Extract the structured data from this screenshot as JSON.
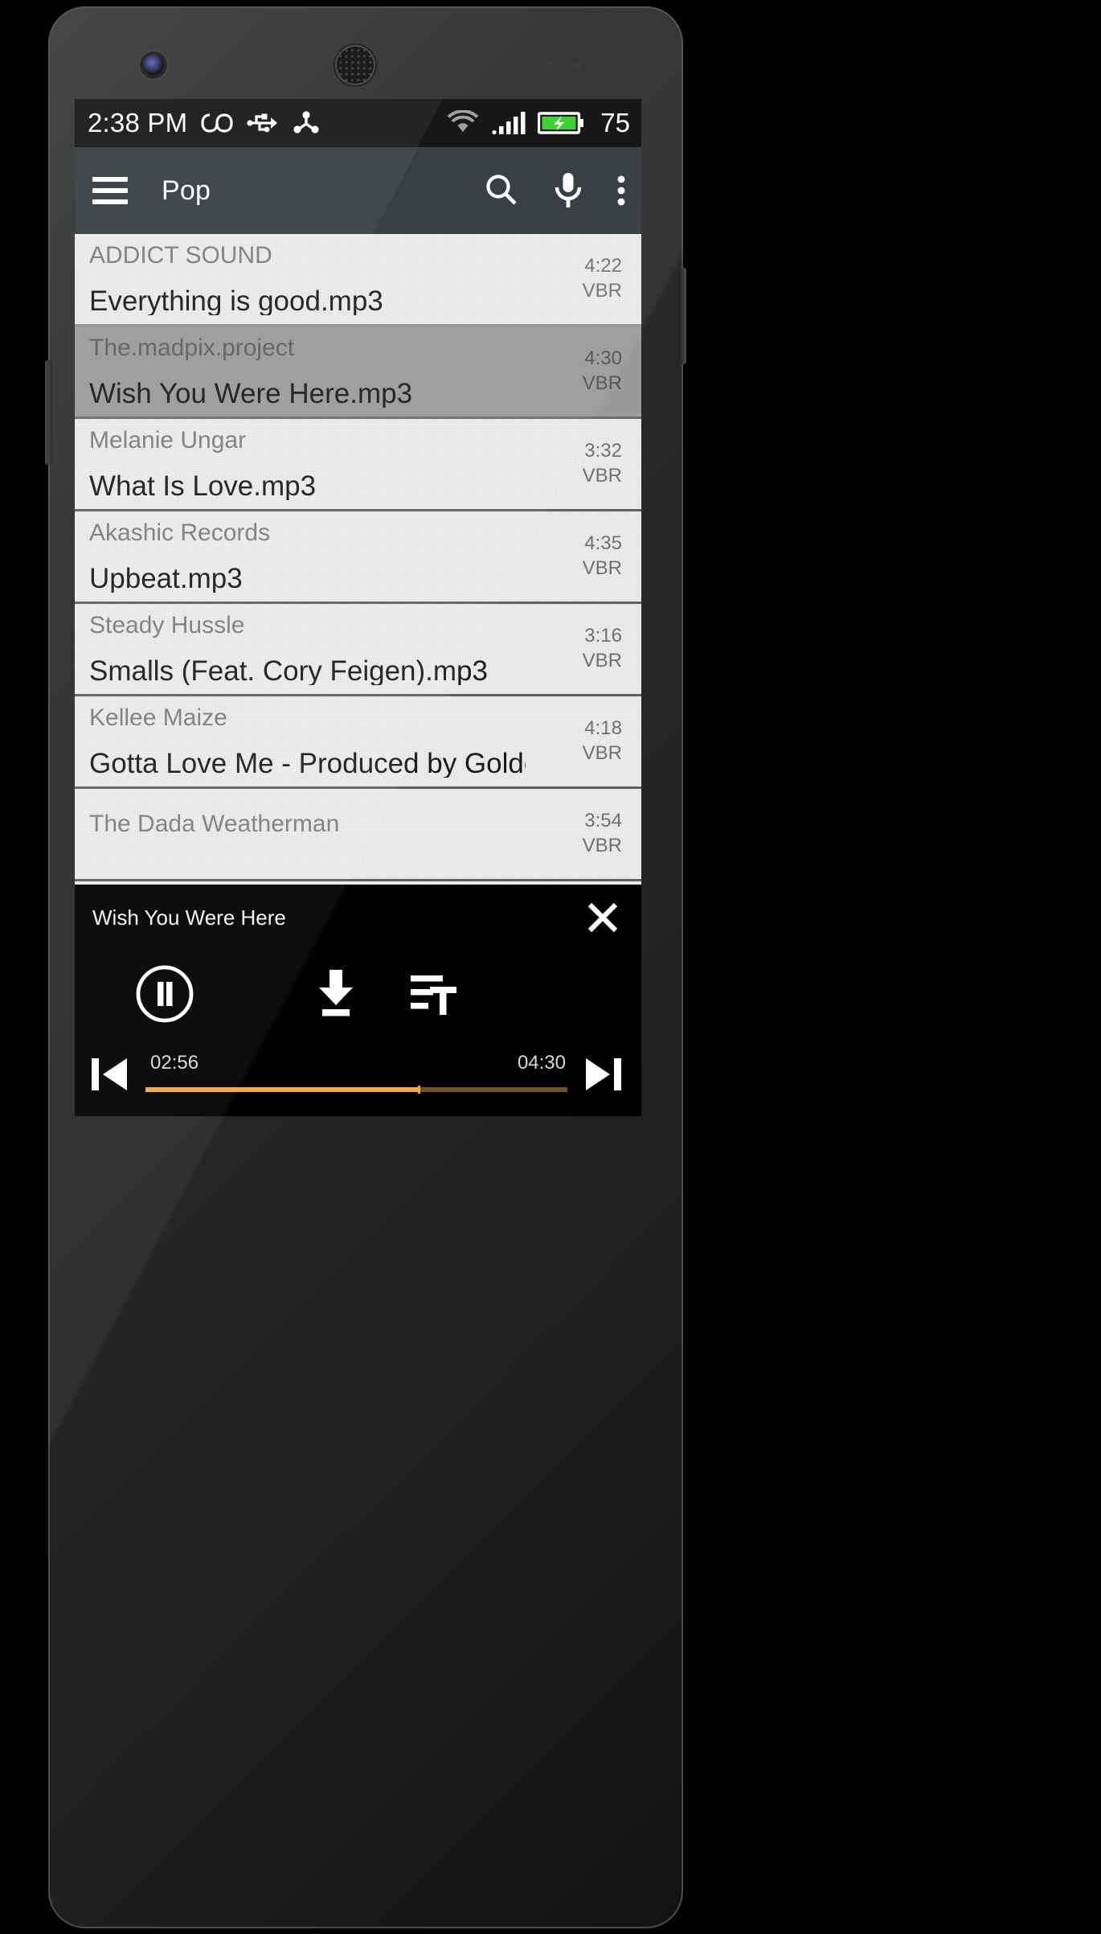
{
  "status_bar": {
    "time": "2:38 PM",
    "icons": [
      "infinity-icon",
      "usb-icon",
      "share-icon"
    ],
    "wifi_icon": "wifi-icon",
    "signal_icon": "signal-bars-icon",
    "battery_icon": "battery-charging-icon",
    "battery_percent": "75"
  },
  "toolbar": {
    "menu_icon": "hamburger-menu-icon",
    "title": "Pop",
    "search_icon": "search-icon",
    "mic_icon": "microphone-icon",
    "overflow_icon": "overflow-menu-icon"
  },
  "songs": [
    {
      "artist": "ADDICT SOUND",
      "title": "Everything is good.mp3",
      "duration": "4:22",
      "bitrate": "VBR",
      "selected": false
    },
    {
      "artist": "The.madpix.project",
      "title": "Wish You Were Here.mp3",
      "duration": "4:30",
      "bitrate": "VBR",
      "selected": true
    },
    {
      "artist": "Melanie Ungar",
      "title": "What Is Love.mp3",
      "duration": "3:32",
      "bitrate": "VBR",
      "selected": false
    },
    {
      "artist": "Akashic Records",
      "title": "Upbeat.mp3",
      "duration": "4:35",
      "bitrate": "VBR",
      "selected": false
    },
    {
      "artist": "Steady Hussle",
      "title": "Smalls (Feat. Cory Feigen).mp3",
      "duration": "3:16",
      "bitrate": "VBR",
      "selected": false
    },
    {
      "artist": "Kellee Maize",
      "title": "Gotta Love Me - Produced by Golden...",
      "duration": "4:18",
      "bitrate": "VBR",
      "selected": false
    },
    {
      "artist": "The Dada Weatherman",
      "title": "",
      "duration": "3:54",
      "bitrate": "VBR",
      "selected": false
    }
  ],
  "player": {
    "track_title": "Wish You Were Here",
    "close_icon": "close-icon",
    "playpause_icon": "pause-circle-icon",
    "download_icon": "download-icon",
    "lyrics_icon": "lyrics-text-icon",
    "prev_icon": "skip-previous-icon",
    "next_icon": "skip-next-icon",
    "elapsed": "02:56",
    "total": "04:30",
    "progress_percent": 65,
    "accent_color": "#f5a93c",
    "track_color": "#6e5523"
  }
}
